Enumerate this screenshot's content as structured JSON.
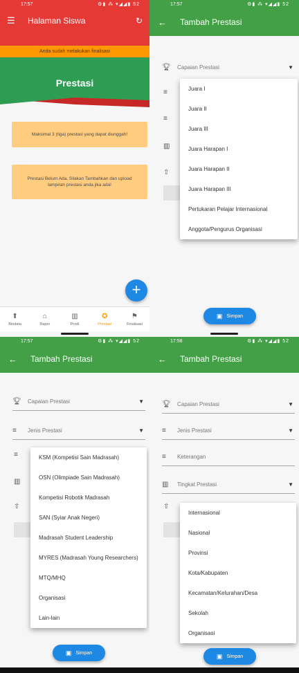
{
  "status": {
    "time": "17:57",
    "icons": "⚙▮ ⁂ ▾◢◢▮ 52"
  },
  "status4": {
    "time": "17:58"
  },
  "colors": {
    "red": "#e53935",
    "green": "#43a047",
    "orange": "#ff9800",
    "blue": "#1e88e5",
    "notice": "#ffcc80"
  },
  "home": {
    "title": "Halaman Siswa",
    "finalisasi_notice": "Anda sudah melakukan finalisasi",
    "hero_title": "Prestasi",
    "notice1": "Maksimal 3 (tiga) prestasi yang dapat diunggah!",
    "notice2": "Prestasi Belum Ada, Silakan Tambahkan dan upload lampiran prestasi anda jika ada!",
    "nav": [
      {
        "label": "Biodata",
        "icon": "person-icon"
      },
      {
        "label": "Rapor",
        "icon": "school-icon"
      },
      {
        "label": "Prodi",
        "icon": "building-icon"
      },
      {
        "label": "Prestasi",
        "icon": "medal-icon"
      },
      {
        "label": "Finalisasi",
        "icon": "flag-icon"
      }
    ]
  },
  "form": {
    "title": "Tambah Prestasi",
    "capaian_label": "Capaian Prestasi",
    "jenis_label": "Jenis Prestasi",
    "keterangan_label": "Keterangan",
    "tingkat_label": "Tingkat Prestasi",
    "save_label": "Simpan"
  },
  "capaian_options": [
    "Juara I",
    "Juara II",
    "Juara III",
    "Juara Harapan I",
    "Juara Harapan II",
    "Juara Harapan III",
    "Pertukaran Pelajar Internasional",
    "Anggota/Pengurus Organisasi"
  ],
  "jenis_options": [
    "KSM (Kompetisi Sain Madrasah)",
    "OSN (Olimpiade Sain Madrasah)",
    "Kompetisi Robotik Madrasah",
    "SAN (Syiar Anak Negeri)",
    "Madrasah Student Leadership",
    "MYRES (Madrasah Young Researchers)",
    "MTQ/MHQ",
    "Organisasi",
    "Lain-lain"
  ],
  "tingkat_options": [
    "Internasional",
    "Nasional",
    "Provinsi",
    "Kota/Kabupaten",
    "Kecamatan/Kelurahan/Desa",
    "Sekolah",
    "Organisasi"
  ]
}
